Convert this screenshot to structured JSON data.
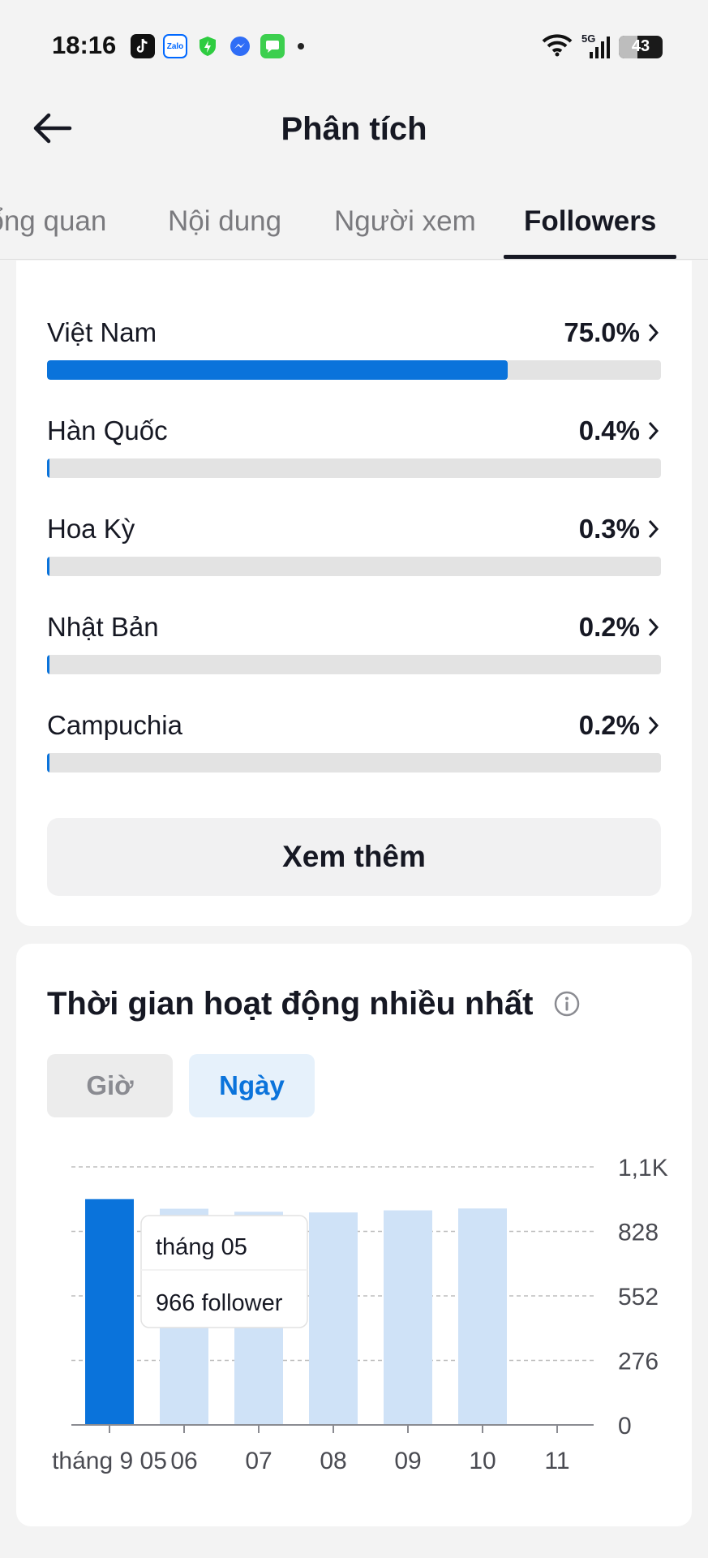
{
  "status": {
    "time": "18:16",
    "network": "5G",
    "battery": "43",
    "battery_level": 0.43,
    "apps": [
      "tiktok-icon",
      "zalo-icon",
      "shield-icon",
      "messenger-icon",
      "messages-icon"
    ],
    "zalo_label": "Zalo"
  },
  "header": {
    "title": "Phân tích"
  },
  "tabs": [
    {
      "label": "Tổng quan",
      "active": false
    },
    {
      "label": "Nội dung",
      "active": false
    },
    {
      "label": "Người xem",
      "active": false
    },
    {
      "label": "Followers",
      "active": true
    }
  ],
  "countries": [
    {
      "name": "Việt Nam",
      "percent_label": "75.0%",
      "percent": 75.0
    },
    {
      "name": "Hàn Quốc",
      "percent_label": "0.4%",
      "percent": 0.4
    },
    {
      "name": "Hoa Kỳ",
      "percent_label": "0.3%",
      "percent": 0.3
    },
    {
      "name": "Nhật Bản",
      "percent_label": "0.2%",
      "percent": 0.2
    },
    {
      "name": "Campuchia",
      "percent_label": "0.2%",
      "percent": 0.2
    }
  ],
  "see_more_label": "Xem thêm",
  "active_time": {
    "title": "Thời gian hoạt động nhiều nhất",
    "segments": [
      {
        "label": "Giờ",
        "active": false
      },
      {
        "label": "Ngày",
        "active": true
      }
    ],
    "tooltip": {
      "title": "tháng 05",
      "value": "966 follower"
    }
  },
  "colors": {
    "accent": "#0a73db",
    "bar_light": "#cfe2f7",
    "track": "#e3e3e3"
  },
  "chart_data": {
    "type": "bar",
    "categories": [
      "tháng 9 05",
      "06",
      "07",
      "08",
      "09",
      "10",
      "11"
    ],
    "values": [
      966,
      925,
      912,
      909,
      918,
      926,
      null
    ],
    "highlighted_index": 0,
    "y_ticks": [
      "0",
      "276",
      "552",
      "828",
      "1,1K"
    ],
    "y_tick_values": [
      0,
      276,
      552,
      828,
      1104
    ],
    "ylim": [
      0,
      1104
    ],
    "grid": true,
    "y_axis_position": "right"
  }
}
